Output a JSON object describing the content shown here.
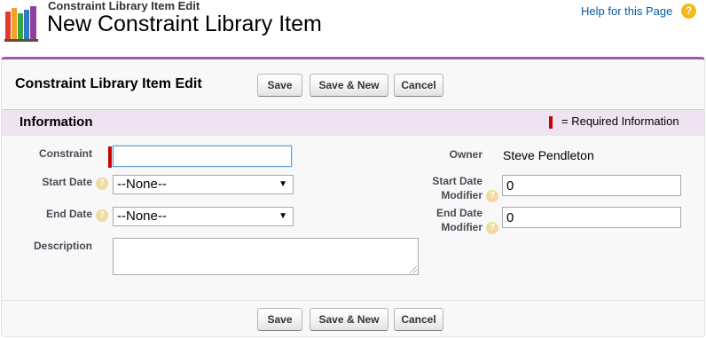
{
  "header": {
    "subtitle": "Constraint Library Item Edit",
    "title": "New Constraint Library Item",
    "help_link": "Help for this Page",
    "help_icon_glyph": "?"
  },
  "panel": {
    "title": "Constraint Library Item Edit",
    "buttons": {
      "save": "Save",
      "save_new": "Save & New",
      "cancel": "Cancel"
    }
  },
  "section": {
    "title": "Information",
    "required_legend": "= Required Information"
  },
  "fields": {
    "constraint": {
      "label": "Constraint",
      "value": "",
      "required": true
    },
    "start_date": {
      "label": "Start Date",
      "value": "--None--"
    },
    "end_date": {
      "label": "End Date",
      "value": "--None--"
    },
    "description": {
      "label": "Description",
      "value": ""
    },
    "owner": {
      "label": "Owner",
      "value": "Steve Pendleton"
    },
    "start_date_modifier": {
      "label_line1": "Start Date",
      "label_line2": "Modifier",
      "value": "0"
    },
    "end_date_modifier": {
      "label_line1": "End Date",
      "label_line2": "Modifier",
      "value": "0"
    }
  },
  "colors": {
    "accent": "#9e5ba6",
    "section_bg": "#efe2f1",
    "required": "#cc0000",
    "link": "#015ba7"
  }
}
